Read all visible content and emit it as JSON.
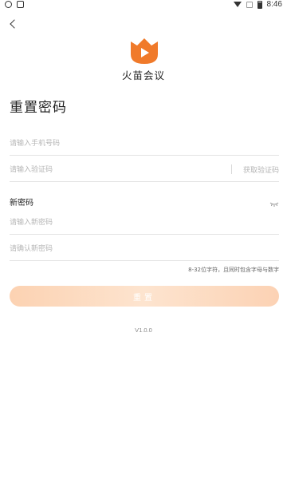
{
  "status_bar": {
    "time": "8:46",
    "icons": [
      "messenger-icon",
      "image-notification-icon",
      "wifi-icon",
      "signal-icon",
      "battery-icon"
    ]
  },
  "header": {
    "back_icon": "back-arrow-icon",
    "app_name": "火苗会议",
    "logo_icon": "flame-play-logo",
    "brand_color": "#f07a2a"
  },
  "page": {
    "title": "重置密码"
  },
  "form": {
    "phone_placeholder": "请输入手机号码",
    "code_placeholder": "请输入验证码",
    "get_code_label": "获取验证码",
    "new_password_section": "新密码",
    "new_password_placeholder": "请输入新密码",
    "confirm_password_placeholder": "请确认新密码",
    "password_hint": "8-32位字符，且同时包含字母与数字",
    "submit_label": "重置"
  },
  "footer": {
    "version": "V1.0.0"
  }
}
